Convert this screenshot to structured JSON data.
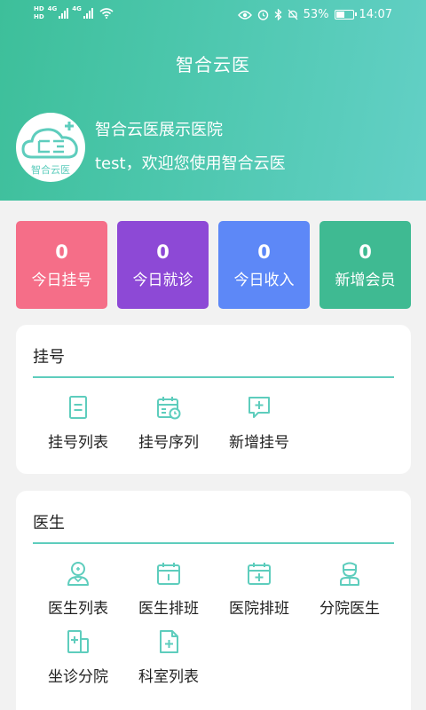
{
  "status_bar": {
    "battery": "53%",
    "time": "14:07",
    "hd": "HD",
    "net": "4G"
  },
  "app_title": "智合云医",
  "profile": {
    "logo_text": "智合云医",
    "hospital_name": "智合云医展示医院",
    "welcome": "test，欢迎您使用智合云医"
  },
  "stats": [
    {
      "value": "0",
      "label": "今日挂号",
      "color": "#f56e88"
    },
    {
      "value": "0",
      "label": "今日就诊",
      "color": "#8d49d6"
    },
    {
      "value": "0",
      "label": "今日收入",
      "color": "#5d88f7"
    },
    {
      "value": "0",
      "label": "新增会员",
      "color": "#3fba92"
    }
  ],
  "accent_color": "#5ecdbd",
  "registration": {
    "title": "挂号",
    "items": [
      {
        "label": "挂号列表",
        "icon": "document-list-icon"
      },
      {
        "label": "挂号序列",
        "icon": "calendar-clock-icon"
      },
      {
        "label": "新增挂号",
        "icon": "chat-add-icon"
      }
    ]
  },
  "doctor": {
    "title": "医生",
    "items": [
      {
        "label": "医生列表",
        "icon": "doctor-icon"
      },
      {
        "label": "医生排班",
        "icon": "calendar-icon"
      },
      {
        "label": "医院排班",
        "icon": "calendar-plus-icon"
      },
      {
        "label": "分院医生",
        "icon": "nurse-icon"
      },
      {
        "label": "坐诊分院",
        "icon": "building-plus-icon"
      },
      {
        "label": "科室列表",
        "icon": "file-plus-icon"
      }
    ]
  }
}
